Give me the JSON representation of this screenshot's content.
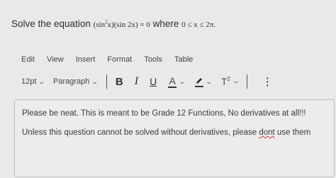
{
  "question": {
    "prefix": "Solve the equation ",
    "math_part1": "(sin",
    "math_exp": "2",
    "math_part2": "x)(sin 2x) = 0",
    "middle": " where ",
    "range": "0 ≤ x ≤ 2π."
  },
  "menubar": {
    "items": [
      "Edit",
      "View",
      "Insert",
      "Format",
      "Tools",
      "Table"
    ]
  },
  "toolbar": {
    "font_size": "12pt",
    "block_format": "Paragraph",
    "bold": "B",
    "italic": "I",
    "underline": "U",
    "text_color": "A",
    "superscript_base": "T",
    "superscript_exp": "2"
  },
  "editor": {
    "paragraph1": "Please be neat. This is meant to be Grade 12 Functions, No derivatives at all!!!",
    "paragraph2_before": "Unless this question cannot be solved without derivatives, please ",
    "paragraph2_misspelled": "dont",
    "paragraph2_after": " use them"
  },
  "colors": {
    "background": "#e9e9ea",
    "text": "#3a3a3a",
    "editor_border": "#bdbdbd",
    "spellcheck": "#d33"
  },
  "icons": {
    "chevron": "chevron-down-icon",
    "highlight": "highlighter-pen-icon",
    "more": "more-vertical-icon"
  }
}
